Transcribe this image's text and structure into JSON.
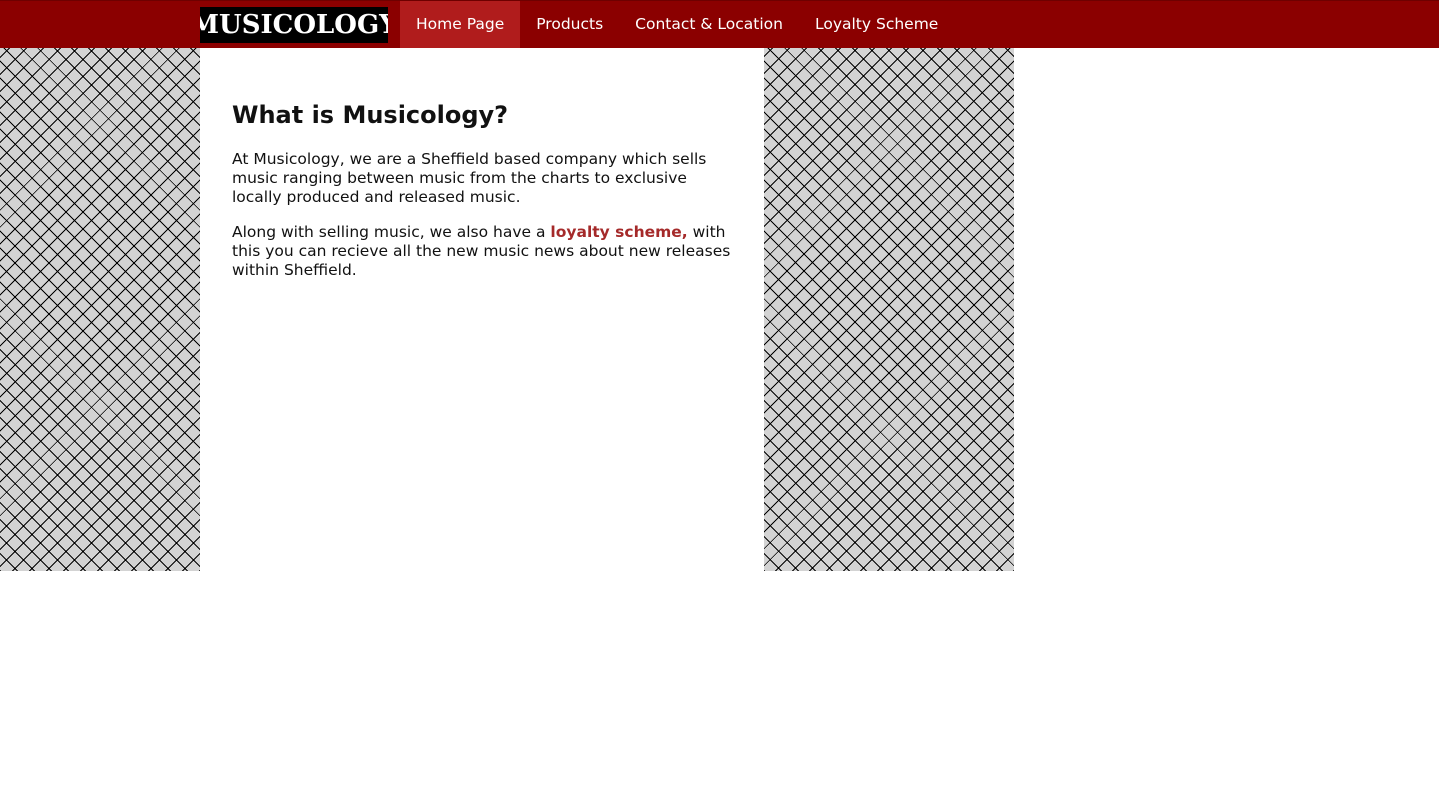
{
  "navbar": {
    "logo_text": "MUSICOLOGY",
    "items": [
      {
        "label": "Home Page",
        "active": true
      },
      {
        "label": "Products",
        "active": false
      },
      {
        "label": "Contact & Location",
        "active": false
      },
      {
        "label": "Loyalty Scheme",
        "active": false
      }
    ]
  },
  "main": {
    "heading": "What is Musicology?",
    "para1": "At Musicology, we are a Sheffield based company which sells music ranging between music from the charts to exclusive locally produced and released music.",
    "para2_before": "Along with selling music, we also have a ",
    "para2_link": "loyalty scheme,",
    "para2_after": " with this you can recieve all the new music news about new releases within Sheffield."
  },
  "colors": {
    "nav_background": "#8b0000",
    "nav_active": "#b01c1c",
    "link": "#a52a2a",
    "panel_background": "#d3d3d3"
  }
}
